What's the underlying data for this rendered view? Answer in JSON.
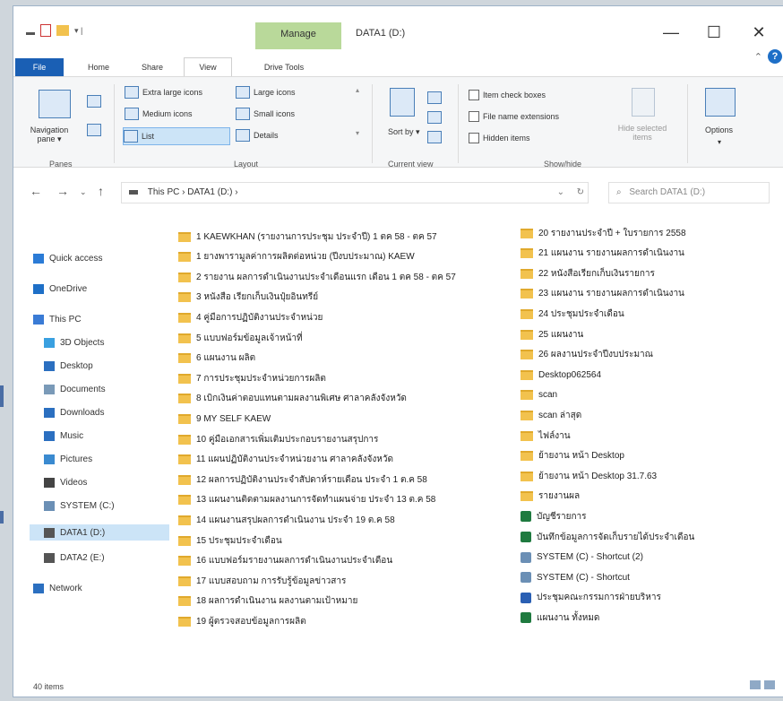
{
  "title_bar": {
    "manage_label": "Manage",
    "window_title": "DATA1 (D:)",
    "minimize": "—",
    "maximize": "☐",
    "close": "✕"
  },
  "ribbon_tabs": [
    "File",
    "Home",
    "Share",
    "View",
    "Drive Tools"
  ],
  "ribbon": {
    "panes": {
      "navigation_pane": "Navigation pane ▾",
      "group_label": "Panes"
    },
    "layout": {
      "items": [
        "Extra large icons",
        "Large icons",
        "Medium icons",
        "Small icons",
        "List",
        "Details"
      ],
      "group_label": "Layout"
    },
    "current_view": {
      "sort_by": "Sort by ▾",
      "group_label": "Current view"
    },
    "show_hide": {
      "items": [
        "Item check boxes",
        "File name extensions",
        "Hidden items"
      ],
      "hide_selected": "Hide selected items",
      "group_label": "Show/hide"
    },
    "options": "Options"
  },
  "address_bar": {
    "path": "This PC  ›  DATA1 (D:)  ›",
    "search_placeholder": "Search DATA1 (D:)"
  },
  "nav_pane": [
    {
      "label": "Quick access",
      "icon": "star-icon",
      "color": "#2b7bd6"
    },
    {
      "label": "OneDrive",
      "icon": "cloud-icon",
      "color": "#1e6fc7"
    },
    {
      "label": "This PC",
      "icon": "pc-icon",
      "color": "#3a7bd5"
    },
    {
      "label": "3D Objects",
      "icon": "cube-icon",
      "color": "#3aa0e0"
    },
    {
      "label": "Desktop",
      "icon": "desktop-icon",
      "color": "#2b6fc0"
    },
    {
      "label": "Documents",
      "icon": "document-icon",
      "color": "#7a9ab8"
    },
    {
      "label": "Downloads",
      "icon": "download-icon",
      "color": "#2b6fc0"
    },
    {
      "label": "Music",
      "icon": "music-icon",
      "color": "#2b6fc0"
    },
    {
      "label": "Pictures",
      "icon": "picture-icon",
      "color": "#3a8ad0"
    },
    {
      "label": "Videos",
      "icon": "video-icon",
      "color": "#444"
    },
    {
      "label": "SYSTEM (C:)",
      "icon": "drive-icon",
      "color": "#6b8fb5"
    },
    {
      "label": "DATA1 (D:)",
      "icon": "drive-icon",
      "color": "#555"
    },
    {
      "label": "DATA2 (E:)",
      "icon": "drive-icon",
      "color": "#555"
    },
    {
      "label": "Network",
      "icon": "network-icon",
      "color": "#2b6fc0"
    }
  ],
  "files_col1": [
    "1 KAEWKHAN (รายงานการประชุม ประจำปี)   1 ตค 58 - ตค 57",
    "1 ยางพารามูลค่าการผลิตต่อหน่วย  (ปีงบประมาณ)  KAEW",
    "2 รายงาน  ผลการดำเนินงานประจำเดือนแรก  เดือน 1 ตค 58 - ตค 57",
    "3 หนังสือ เรียกเก็บเงินปุ๋ยอินทรีย์",
    "4 คู่มือการปฏิบัติงานประจำหน่วย",
    "5 แบบฟอร์มข้อมูลเจ้าหน้าที่",
    "6 แผนงาน ผลิต",
    "7 การประชุมประจำหน่วยการผลิต",
    "8 เบิกเงินค่าตอบแทนตามผลงานพิเศษ ศาลาคลังจังหวัด",
    "9 MY SELF KAEW",
    "10 คู่มือเอกสารเพิ่มเติมประกอบรายงานสรุปการ",
    "11 แผนปฏิบัติงานประจำหน่วยงาน ศาลาคลังจังหวัด",
    "12 ผลการปฏิบัติงานประจำสัปดาห์รายเดือน  ประจำ 1 ต.ค 58",
    "13 แผนงานติดตามผลงานการจัดทำแผนจ่าย ประจำ 13 ต.ค 58",
    "14 แผนงานสรุปผลการดำเนินงาน  ประจำ 19 ต.ค 58",
    "15 ประชุมประจำเดือน",
    "16 แบบฟอร์มรายงานผลการดำเนินงานประจำเดือน",
    "17 แบบสอบถาม การรับรู้ข้อมูลข่าวสาร",
    "18 ผลการดำเนินงาน ผลงานตามเป้าหมาย",
    "19 ผู้ตรวจสอบข้อมูลการผลิต"
  ],
  "files_col2": [
    {
      "name": "20 รายงานประจำปี + ใบรายการ 2558",
      "type": "folder"
    },
    {
      "name": "21 แผนงาน รายงานผลการดำเนินงาน",
      "type": "folder"
    },
    {
      "name": "22 หนังสือเรียกเก็บเงินรายการ",
      "type": "folder"
    },
    {
      "name": "23 แผนงาน รายงานผลการดำเนินงาน",
      "type": "folder"
    },
    {
      "name": "24 ประชุมประจำเดือน",
      "type": "folder"
    },
    {
      "name": "25 แผนงาน",
      "type": "folder"
    },
    {
      "name": "26 ผลงานประจำปีงบประมาณ",
      "type": "folder"
    },
    {
      "name": "Desktop062564",
      "type": "folder"
    },
    {
      "name": "scan",
      "type": "folder"
    },
    {
      "name": "scan ล่าสุด",
      "type": "folder"
    },
    {
      "name": "ไฟล์งาน",
      "type": "folder"
    },
    {
      "name": "ย้ายงาน หน้า Desktop",
      "type": "folder"
    },
    {
      "name": "ย้ายงาน หน้า Desktop 31.7.63",
      "type": "folder"
    },
    {
      "name": "รายงานผล",
      "type": "folder"
    },
    {
      "name": "บัญชีรายการ",
      "type": "excel"
    },
    {
      "name": "บันทึกข้อมูลการจัดเก็บรายได้ประจำเดือน",
      "type": "excel"
    },
    {
      "name": "SYSTEM (C) - Shortcut (2)",
      "type": "shortcut"
    },
    {
      "name": "SYSTEM (C) - Shortcut",
      "type": "shortcut"
    },
    {
      "name": "ประชุมคณะกรรมการฝ่ายบริหาร",
      "type": "word"
    },
    {
      "name": "แผนงาน ทั้งหมด",
      "type": "excel"
    }
  ],
  "status_bar": {
    "item_count": "40 items"
  }
}
